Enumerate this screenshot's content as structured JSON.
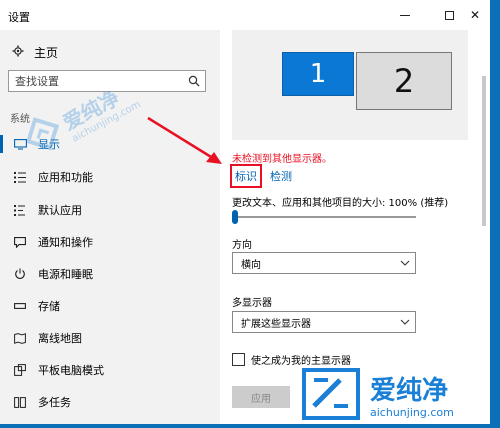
{
  "window": {
    "title": "设置"
  },
  "sidebar": {
    "home_label": "主页",
    "search_placeholder": "查找设置",
    "section_label": "系统",
    "items": [
      {
        "label": "显示",
        "icon": "monitor-icon"
      },
      {
        "label": "应用和功能",
        "icon": "list-icon"
      },
      {
        "label": "默认应用",
        "icon": "default-apps-icon"
      },
      {
        "label": "通知和操作",
        "icon": "notification-icon"
      },
      {
        "label": "电源和睡眠",
        "icon": "power-icon"
      },
      {
        "label": "存储",
        "icon": "storage-icon"
      },
      {
        "label": "离线地图",
        "icon": "map-icon"
      },
      {
        "label": "平板电脑模式",
        "icon": "tablet-icon"
      },
      {
        "label": "多任务",
        "icon": "multitask-icon"
      }
    ]
  },
  "display": {
    "monitor1_label": "1",
    "monitor2_label": "2",
    "error_text": "未检测到其他显示器。",
    "identify_link": "标识",
    "detect_link": "检测",
    "scale_label": "更改文本、应用和其他项目的大小: 100% (推荐)",
    "scale_slider_fraction": 0,
    "orientation_label": "方向",
    "orientation_value": "横向",
    "multi_label": "多显示器",
    "multi_value": "扩展这些显示器",
    "primary_checkbox_label": "使之成为我的主显示器",
    "primary_checked": false,
    "apply_button": "应用"
  },
  "watermarks": {
    "brand": "爱纯净",
    "url": "aichunjing.com"
  },
  "colors": {
    "accent": "#0063b1",
    "error": "#e81123",
    "monitor_active": "#0a78d4",
    "watermark": "#1a7fd6"
  }
}
